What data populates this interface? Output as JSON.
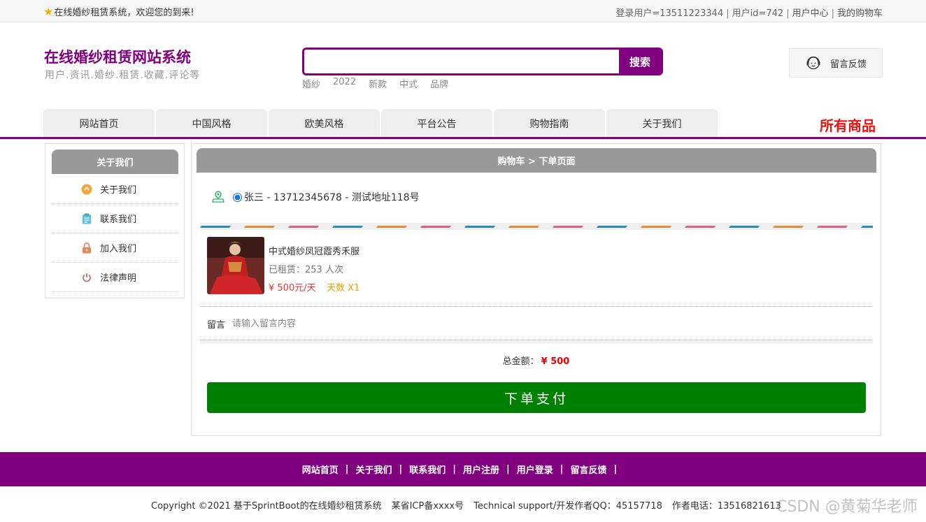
{
  "topbar": {
    "welcome": "在线婚纱租赁系统，欢迎您的到来!",
    "user_login": "登录用户=13511223344",
    "user_id": "用户id=742",
    "user_center": "用户中心",
    "cart": "我的购物车"
  },
  "header": {
    "title": "在线婚纱租赁网站系统",
    "subtitle": "用户.资讯.婚纱.租赁.收藏.评论等",
    "search": {
      "value": "",
      "button": "搜索"
    },
    "hot_words": [
      "婚纱",
      "2022",
      "新款",
      "中式",
      "品牌"
    ],
    "feedback": "留言反馈"
  },
  "nav": {
    "items": [
      "网站首页",
      "中国风格",
      "欧美风格",
      "平台公告",
      "购物指南",
      "关于我们"
    ],
    "all_goods": "所有商品"
  },
  "sidebar": {
    "title": "关于我们",
    "items": [
      {
        "label": "关于我们",
        "icon": "info-badge-icon",
        "color": "#f5a33a"
      },
      {
        "label": "联系我们",
        "icon": "clipboard-icon",
        "color": "#5bc0de"
      },
      {
        "label": "加入我们",
        "icon": "lock-icon",
        "color": "#e08a5a"
      },
      {
        "label": "法律声明",
        "icon": "power-icon",
        "color": "#c0706a"
      }
    ]
  },
  "order": {
    "breadcrumb": "购物车 > 下单页面",
    "address": "张三 - 13712345678 - 测试地址118号",
    "product": {
      "name": "中式婚纱凤冠霞秀禾服",
      "rented": "已租赁：253 人次",
      "price": "¥ 500元/天",
      "days": "天数 X1"
    },
    "remark_label": "留言",
    "remark_placeholder": "请输入留言内容",
    "total_label": "总金额：",
    "total_amount": "¥ 500",
    "pay_button": "下单支付"
  },
  "footer": {
    "links": [
      "网站首页",
      "关于我们",
      "联系我们",
      "用户注册",
      "用户登录",
      "留言反馈"
    ],
    "copyright": "Copyright ©2021 基于SprintBoot的在线婚纱租赁系统",
    "icp": "某省ICP备xxxx号",
    "support": "Technical support/开发作者QQ：45157718",
    "phone": "作者电话：13516821613"
  },
  "watermark": "CSDN @黄菊华老师",
  "colors": {
    "brand": "#800080",
    "pay": "#008000",
    "price": "#ee1111",
    "header_bar": "#999999"
  }
}
